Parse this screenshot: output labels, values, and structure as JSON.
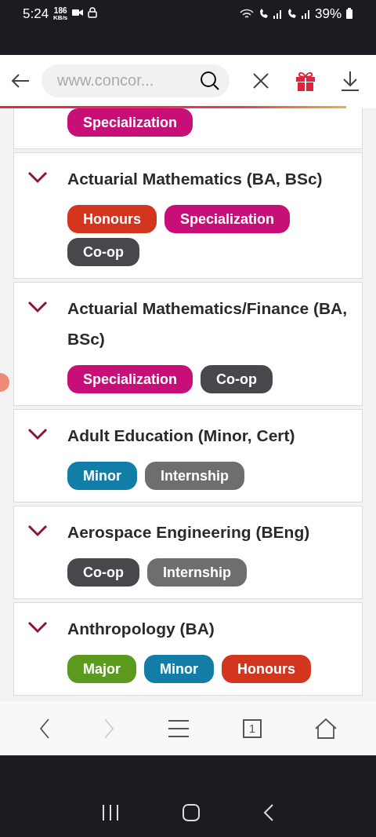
{
  "status_bar": {
    "time": "5:24",
    "speed": "186",
    "speed_unit": "KB/s",
    "battery": "39%"
  },
  "toolbar": {
    "url": "www.concor...",
    "progress": {
      "level": 0.92
    }
  },
  "programs": [
    {
      "tags": [
        {
          "label": "Specialization",
          "color": "#c80f78"
        }
      ]
    },
    {
      "title": "Actuarial Mathematics (BA, BSc)",
      "expanded": false,
      "tags": [
        {
          "label": "Honours",
          "color": "#d2361e"
        },
        {
          "label": "Specialization",
          "color": "#c80f78"
        },
        {
          "label": "Co-op",
          "color": "#48484c"
        }
      ]
    },
    {
      "title": "Actuarial Mathematics/Finance (BA, BSc)",
      "expanded": false,
      "tags": [
        {
          "label": "Specialization",
          "color": "#c80f78"
        },
        {
          "label": "Co-op",
          "color": "#48484c"
        }
      ]
    },
    {
      "title": "Adult Education (Minor, Cert)",
      "expanded": false,
      "tags": [
        {
          "label": "Minor",
          "color": "#127ea8"
        },
        {
          "label": "Internship",
          "color": "#6e6e70"
        }
      ]
    },
    {
      "title": "Aerospace Engineering (BEng)",
      "expanded": false,
      "tags": [
        {
          "label": "Co-op",
          "color": "#48484c"
        },
        {
          "label": "Internship",
          "color": "#6e6e70"
        }
      ]
    },
    {
      "title": "Anthropology (BA)",
      "expanded": false,
      "tags": [
        {
          "label": "Major",
          "color": "#5c9a1e"
        },
        {
          "label": "Minor",
          "color": "#127ea8"
        },
        {
          "label": "Honours",
          "color": "#d2361e"
        }
      ]
    }
  ],
  "bottom_nav": {
    "forward": {
      "disabled": true
    },
    "tab_count": "1"
  }
}
